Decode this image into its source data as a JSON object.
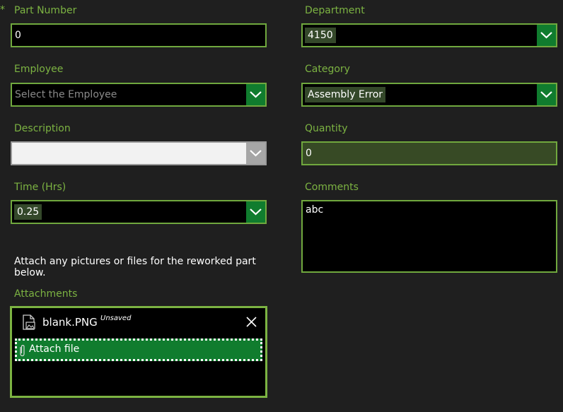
{
  "form": {
    "part_number": {
      "label": "Part Number",
      "required_marker": "*",
      "value": "0"
    },
    "department": {
      "label": "Department",
      "value": "4150"
    },
    "employee": {
      "label": "Employee",
      "placeholder": "Select the Employee",
      "value": ""
    },
    "category": {
      "label": "Category",
      "value": "Assembly Error"
    },
    "description": {
      "label": "Description",
      "value": ""
    },
    "quantity": {
      "label": "Quantity",
      "value": "0"
    },
    "time": {
      "label": "Time (Hrs)",
      "value": "0.25"
    },
    "comments": {
      "label": "Comments",
      "value": "abc"
    },
    "attach_note": "Attach any pictures or files for the reworked part below.",
    "attachments": {
      "label": "Attachments",
      "files": [
        {
          "name": "blank.PNG",
          "status": "Unsaved",
          "icon": "image-file-icon"
        }
      ],
      "attach_button_label": "Attach file"
    }
  },
  "colors": {
    "background": "#1f1f1f",
    "label": "#7cb342",
    "border": "#70a83e",
    "dropdown_button": "#107c2e",
    "chip": "#34482a"
  }
}
